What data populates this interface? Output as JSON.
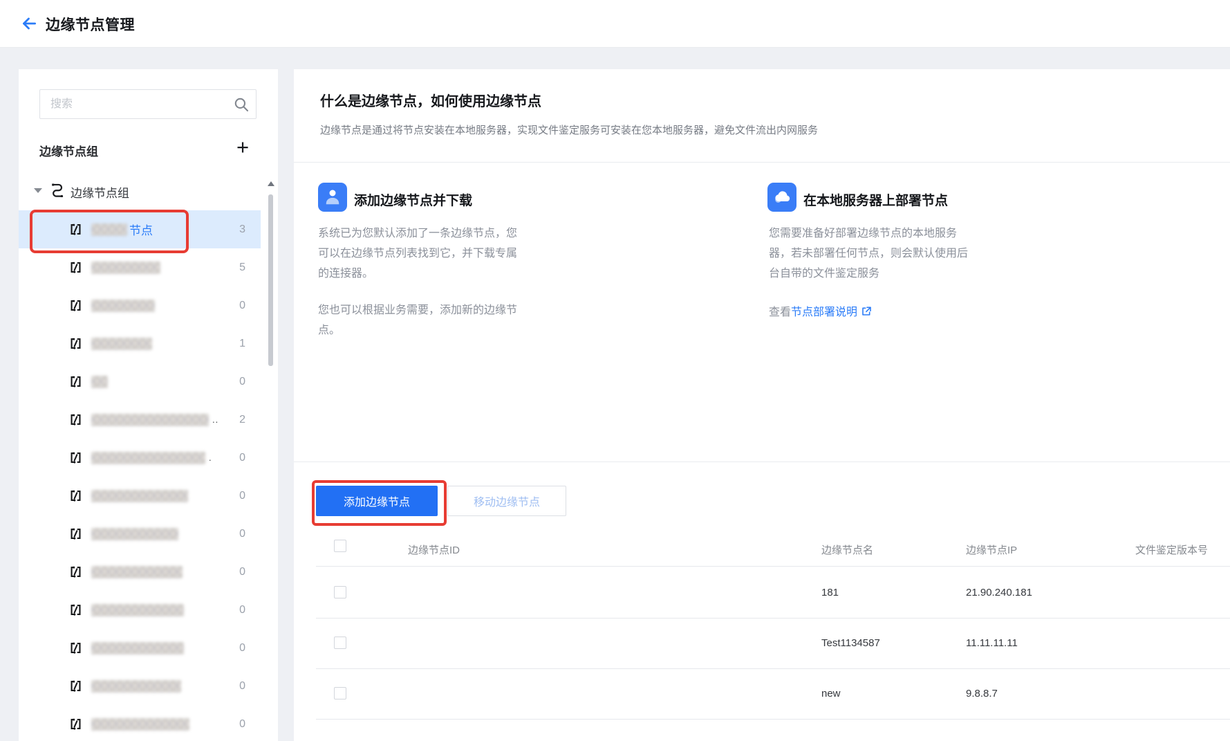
{
  "colors": {
    "accent": "#2b7cf8",
    "button_bg": "#2270f4",
    "annotation": "#e73c33",
    "selected_bg": "#dcebfd",
    "icon_bg": "#3a7df7"
  },
  "header": {
    "title": "边缘节点管理"
  },
  "sidebar": {
    "search_placeholder": "搜索",
    "section_title": "边缘节点组",
    "root_label": "边缘节点组",
    "items": [
      {
        "selected": true,
        "name_suffix": "节点",
        "name_width": 52,
        "count": "3"
      },
      {
        "name_width": 100,
        "count": "5"
      },
      {
        "name_width": 92,
        "count": "0"
      },
      {
        "name_width": 88,
        "count": "1"
      },
      {
        "name_width": 24,
        "count": "0"
      },
      {
        "name_width": 170,
        "count": "2",
        "trunc": ".."
      },
      {
        "name_width": 165,
        "count": "0",
        "trunc": "."
      },
      {
        "name_width": 140,
        "count": "0"
      },
      {
        "name_width": 126,
        "count": "0"
      },
      {
        "name_width": 132,
        "count": "0"
      },
      {
        "name_width": 134,
        "count": "0"
      },
      {
        "name_width": 134,
        "count": "0"
      },
      {
        "name_width": 130,
        "count": "0"
      },
      {
        "name_width": 142,
        "count": "0"
      }
    ]
  },
  "main": {
    "intro_title": "什么是边缘节点，如何使用边缘节点",
    "intro_desc": "边缘节点是通过将节点安装在本地服务器，实现文件鉴定服务可安装在您本地服务器，避免文件流出内网服务",
    "card_add": {
      "title": "添加边缘节点并下载",
      "p1": "系统已为您默认添加了一条边缘节点，您可以在边缘节点列表找到它，并下载专属的连接器。",
      "p2": "您也可以根据业务需要，添加新的边缘节点。"
    },
    "card_deploy": {
      "title": "在本地服务器上部署节点",
      "p1": "您需要准备好部署边缘节点的本地服务器，若未部署任何节点，则会默认使用后台自带的文件鉴定服务",
      "link_prefix": "查看",
      "link_text": "节点部署说明"
    },
    "toolbar": {
      "add_button": "添加边缘节点",
      "move_button": "移动边缘节点"
    },
    "table": {
      "columns": [
        "边缘节点ID",
        "边缘节点名",
        "边缘节点IP",
        "文件鉴定版本号"
      ],
      "rows": [
        {
          "name": "181",
          "ip": "21.90.240.181"
        },
        {
          "name": "Test1134587",
          "ip": "11.11.11.11"
        },
        {
          "name": "new",
          "ip": "9.8.8.7"
        }
      ]
    }
  }
}
